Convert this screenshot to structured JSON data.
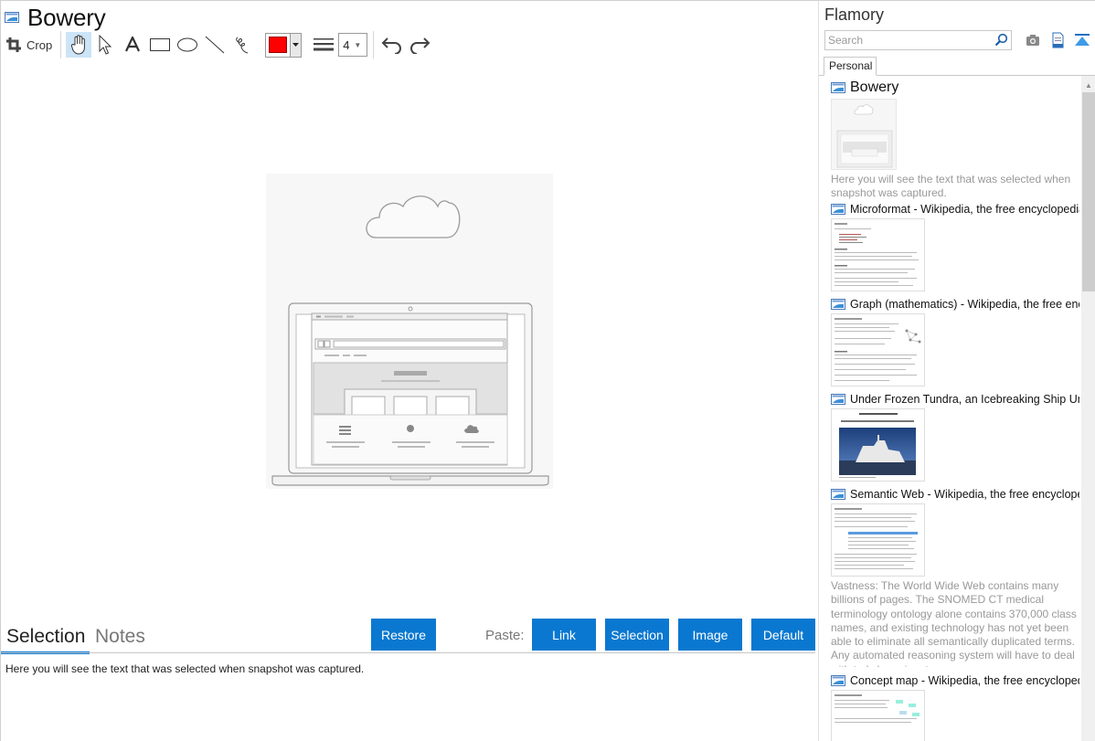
{
  "window": {
    "title": "Bowery"
  },
  "toolbar": {
    "crop_label": "Crop",
    "line_width_value": "4",
    "draw_color": "#ff0000",
    "tools": [
      "hand-icon",
      "pointer-icon",
      "text-icon",
      "rectangle-icon",
      "ellipse-icon",
      "line-icon",
      "freehand-icon"
    ]
  },
  "bottom": {
    "tabs": [
      "Selection",
      "Notes"
    ],
    "active_tab": "Selection",
    "restore_label": "Restore",
    "paste_label": "Paste:",
    "paste_buttons": [
      "Link",
      "Selection",
      "Image",
      "Default"
    ],
    "selection_text": "Here you will see the text that was selected when snapshot was captured."
  },
  "panel": {
    "app_name": "Flamory",
    "search_placeholder": "Search",
    "tab_personal": "Personal",
    "items": [
      {
        "title": "Bowery",
        "desc": "Here you will see the text that was selected when snapshot was captured."
      },
      {
        "title": "Microformat - Wikipedia, the free encyclopedia"
      },
      {
        "title": "Graph (mathematics) - Wikipedia, the free ency"
      },
      {
        "title": "Under Frozen Tundra, an Icebreaking Ship Unco"
      },
      {
        "title": "Semantic Web - Wikipedia, the free encycloped",
        "desc": "Vastness: The World Wide Web contains many billions of pages. The SNOMED CT medical terminology ontology alone contains 370,000 class names, and existing technology has not yet been able to eliminate all semantically duplicated terms. Any automated reasoning system will have to deal with truly huge inputs."
      },
      {
        "title": "Concept map - Wikipedia, the free encyclopedi"
      }
    ]
  },
  "colors": {
    "accent": "#0a78d0",
    "selected_tool_bg": "#cce4f7"
  }
}
